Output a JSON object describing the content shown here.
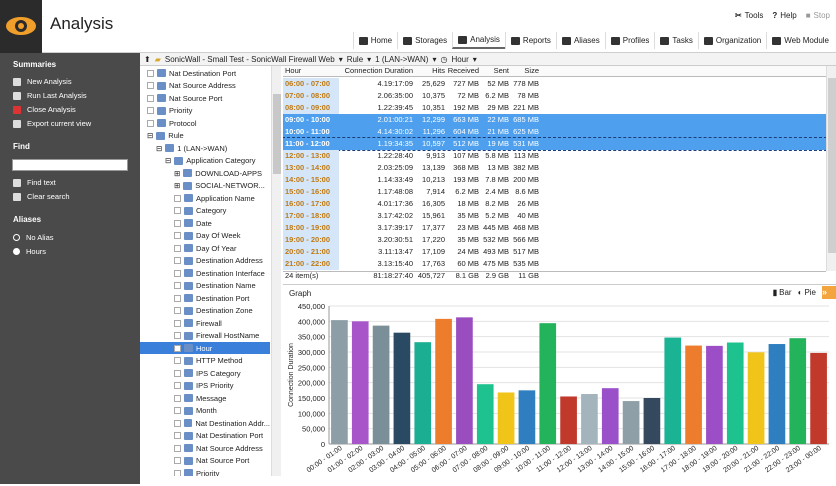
{
  "app": {
    "title": "Analysis"
  },
  "top_links": [
    {
      "icon": "tools-icon",
      "label": "Tools"
    },
    {
      "icon": "help-icon",
      "label": "Help"
    },
    {
      "icon": "stop-icon",
      "label": "Stop"
    }
  ],
  "tabs": [
    {
      "icon": "home-icon",
      "label": "Home"
    },
    {
      "icon": "storages-icon",
      "label": "Storages"
    },
    {
      "icon": "analysis-eye-icon",
      "label": "Analysis",
      "active": true
    },
    {
      "icon": "reports-icon",
      "label": "Reports"
    },
    {
      "icon": "aliases-icon",
      "label": "Aliases"
    },
    {
      "icon": "profiles-icon",
      "label": "Profiles"
    },
    {
      "icon": "tasks-icon",
      "label": "Tasks"
    },
    {
      "icon": "organization-icon",
      "label": "Organization"
    },
    {
      "icon": "web-module-icon",
      "label": "Web Module"
    }
  ],
  "sidebar": {
    "summaries_title": "Summaries",
    "summaries": [
      "New Analysis",
      "Run Last Analysis",
      "Close Analysis",
      "Export current view"
    ],
    "find_title": "Find",
    "find_value": "",
    "find_items": [
      "Find text",
      "Clear search"
    ],
    "aliases_title": "Aliases",
    "aliases": [
      {
        "label": "No Alias",
        "selected": false
      },
      {
        "label": "Hours",
        "selected": true
      }
    ]
  },
  "breadcrumb": {
    "source": "SonicWall - Small Test - SonicWall Firewall Web",
    "rule": "Rule",
    "rule_value": "1 (LAN->WAN)",
    "field": "Hour"
  },
  "tree": [
    {
      "label": "Nat Destination Port",
      "indent": 1
    },
    {
      "label": "Nat Source Address",
      "indent": 1
    },
    {
      "label": "Nat Source Port",
      "indent": 1
    },
    {
      "label": "Priority",
      "indent": 1
    },
    {
      "label": "Protocol",
      "indent": 1
    },
    {
      "label": "Rule",
      "indent": 1,
      "expand": "minus"
    },
    {
      "label": "1 (LAN->WAN)",
      "indent": 2,
      "expand": "minus"
    },
    {
      "label": "Application Category",
      "indent": 3,
      "expand": "minus"
    },
    {
      "label": "DOWNLOAD-APPS",
      "indent": 4,
      "expand": "plus"
    },
    {
      "label": "SOCIAL-NETWOR...",
      "indent": 4,
      "expand": "plus"
    },
    {
      "label": "Application Name",
      "indent": 4
    },
    {
      "label": "Category",
      "indent": 4
    },
    {
      "label": "Date",
      "indent": 4
    },
    {
      "label": "Day Of Week",
      "indent": 4
    },
    {
      "label": "Day Of Year",
      "indent": 4
    },
    {
      "label": "Destination Address",
      "indent": 4
    },
    {
      "label": "Destination Interface",
      "indent": 4
    },
    {
      "label": "Destination Name",
      "indent": 4
    },
    {
      "label": "Destination Port",
      "indent": 4
    },
    {
      "label": "Destination Zone",
      "indent": 4
    },
    {
      "label": "Firewall",
      "indent": 4
    },
    {
      "label": "Firewall HostName",
      "indent": 4
    },
    {
      "label": "Hour",
      "indent": 4,
      "selected": true
    },
    {
      "label": "HTTP Method",
      "indent": 4
    },
    {
      "label": "IPS Category",
      "indent": 4
    },
    {
      "label": "IPS Priority",
      "indent": 4
    },
    {
      "label": "Message",
      "indent": 4
    },
    {
      "label": "Month",
      "indent": 4
    },
    {
      "label": "Nat Destination Addr...",
      "indent": 4
    },
    {
      "label": "Nat Destination Port",
      "indent": 4
    },
    {
      "label": "Nat Source Address",
      "indent": 4
    },
    {
      "label": "Nat Source Port",
      "indent": 4
    },
    {
      "label": "Priority",
      "indent": 4
    }
  ],
  "table": {
    "columns": [
      "Hour",
      "Connection Duration",
      "Hits",
      "Received",
      "Sent",
      "Size"
    ],
    "rows": [
      [
        "06:00 - 07:00",
        "4.19:17:09",
        "25,629",
        "727 MB",
        "52 MB",
        "778 MB"
      ],
      [
        "07:00 - 08:00",
        "2.06:35:00",
        "10,375",
        "72 MB",
        "6.2 MB",
        "78 MB"
      ],
      [
        "08:00 - 09:00",
        "1.22:39:45",
        "10,351",
        "192 MB",
        "29 MB",
        "221 MB"
      ],
      [
        "09:00 - 10:00",
        "2.01:00:21",
        "12,299",
        "663 MB",
        "22 MB",
        "685 MB"
      ],
      [
        "10:00 - 11:00",
        "4.14:30:02",
        "11,296",
        "604 MB",
        "21 MB",
        "625 MB"
      ],
      [
        "11:00 - 12:00",
        "1.19:34:35",
        "10,597",
        "512 MB",
        "19 MB",
        "531 MB"
      ],
      [
        "12:00 - 13:00",
        "1.22:28:40",
        "9,913",
        "107 MB",
        "5.8 MB",
        "113 MB"
      ],
      [
        "13:00 - 14:00",
        "2.03:25:09",
        "13,139",
        "368 MB",
        "13 MB",
        "382 MB"
      ],
      [
        "14:00 - 15:00",
        "1.14:33:49",
        "10,213",
        "193 MB",
        "7.8 MB",
        "200 MB"
      ],
      [
        "15:00 - 16:00",
        "1.17:48:08",
        "7,914",
        "6.2 MB",
        "2.4 MB",
        "8.6 MB"
      ],
      [
        "16:00 - 17:00",
        "4.01:17:36",
        "16,305",
        "18 MB",
        "8.2 MB",
        "26 MB"
      ],
      [
        "17:00 - 18:00",
        "3.17:42:02",
        "15,961",
        "35 MB",
        "5.2 MB",
        "40 MB"
      ],
      [
        "18:00 - 19:00",
        "3.17:39:17",
        "17,377",
        "23 MB",
        "445 MB",
        "468 MB"
      ],
      [
        "19:00 - 20:00",
        "3.20:30:51",
        "17,220",
        "35 MB",
        "532 MB",
        "566 MB"
      ],
      [
        "20:00 - 21:00",
        "3.11:13:47",
        "17,109",
        "24 MB",
        "493 MB",
        "517 MB"
      ],
      [
        "21:00 - 22:00",
        "3.13:15:40",
        "17,763",
        "60 MB",
        "475 MB",
        "535 MB"
      ]
    ],
    "selected_rows": [
      3,
      4
    ],
    "focused_row": 5,
    "summary": {
      "items": "24 item(s)",
      "duration": "81:18:27:40",
      "hits": "405,727",
      "received": "8.1 GB",
      "sent": "2.9 GB",
      "size": "11 GB"
    }
  },
  "graph": {
    "title": "Graph",
    "bar_label": "Bar",
    "pie_label": "Pie"
  },
  "chart_data": {
    "type": "bar",
    "ylabel": "Connection Duration",
    "ylim": [
      0,
      450000
    ],
    "yticks": [
      "0",
      "50,000",
      "100,000",
      "150,000",
      "200,000",
      "250,000",
      "300,000",
      "350,000",
      "400,000",
      "450,000"
    ],
    "categories": [
      "00:00 - 01:00",
      "01:00 - 02:00",
      "02:00 - 03:00",
      "03:00 - 04:00",
      "04:00 - 05:00",
      "05:00 - 06:00",
      "06:00 - 07:00",
      "07:00 - 08:00",
      "08:00 - 09:00",
      "09:00 - 10:00",
      "10:00 - 11:00",
      "11:00 - 12:00",
      "12:00 - 13:00",
      "13:00 - 14:00",
      "14:00 - 15:00",
      "15:00 - 16:00",
      "16:00 - 17:00",
      "17:00 - 18:00",
      "18:00 - 19:00",
      "19:00 - 20:00",
      "20:00 - 21:00",
      "21:00 - 22:00",
      "22:00 - 23:00",
      "23:00 - 00:00"
    ],
    "values": [
      404000,
      400000,
      386000,
      363000,
      332000,
      408000,
      413000,
      195000,
      168000,
      175000,
      394000,
      155000,
      163000,
      182000,
      140000,
      150000,
      347000,
      321000,
      320000,
      331000,
      299000,
      326000,
      345000,
      297000
    ],
    "colors": [
      "#8e9ea6",
      "#a855c9",
      "#7b8f98",
      "#2a4a63",
      "#1bae92",
      "#ed7d2c",
      "#9a4dbf",
      "#1ec28e",
      "#f0c419",
      "#2f7fc0",
      "#23b35b",
      "#c0392b",
      "#a4b4bd",
      "#9a50c8",
      "#8f9fa7",
      "#34495e",
      "#1ab394",
      "#ed7d2c",
      "#9b4ec6",
      "#1ec28e",
      "#f0c419",
      "#2f7fc0",
      "#23b35b",
      "#c0392b"
    ]
  }
}
